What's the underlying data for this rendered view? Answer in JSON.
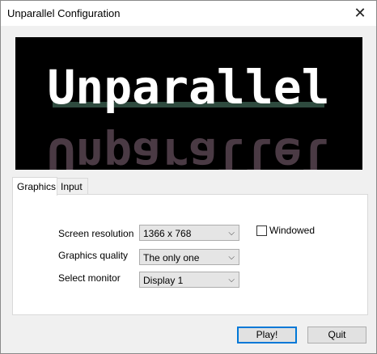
{
  "window": {
    "title": "Unparallel Configuration",
    "close_glyph": "✕",
    "close_icon": "close-icon"
  },
  "banner": {
    "logo_text": "Unparallel",
    "colors": {
      "background": "#000000",
      "text": "#ffffff",
      "line": "#2e4a3e",
      "reflection": "#4a3a44"
    }
  },
  "tabs": [
    {
      "label": "Graphics",
      "active": true
    },
    {
      "label": "Input",
      "active": false
    }
  ],
  "graphics": {
    "resolution": {
      "label": "Screen resolution",
      "value": "1366 x 768"
    },
    "quality": {
      "label": "Graphics quality",
      "value": "The only one"
    },
    "monitor": {
      "label": "Select monitor",
      "value": "Display 1"
    },
    "windowed": {
      "label": "Windowed",
      "checked": false
    }
  },
  "buttons": {
    "play_label": "Play!",
    "quit_label": "Quit"
  },
  "colors": {
    "accent": "#0078d7"
  }
}
